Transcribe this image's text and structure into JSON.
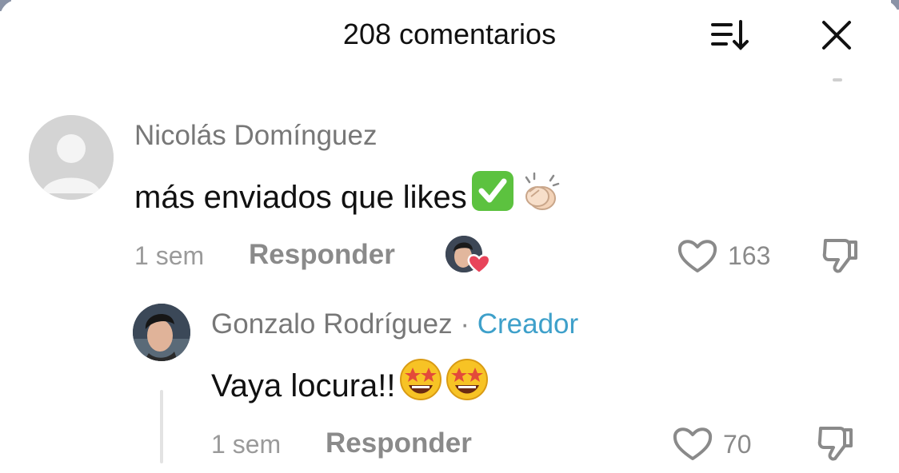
{
  "header": {
    "title": "208 comentarios"
  },
  "comments": [
    {
      "author": "Nicolás Domínguez",
      "text": "más enviados que likes",
      "time": "1 sem",
      "reply_label": "Responder",
      "likes": "163",
      "emojis": [
        "check-mark-emoji",
        "clapping-hands-emoji"
      ]
    }
  ],
  "reply": {
    "author": "Gonzalo Rodríguez",
    "separator": "·",
    "badge": "Creador",
    "text": "Vaya locura!!",
    "time": "1 sem",
    "reply_label": "Responder",
    "likes": "70",
    "emojis": [
      "star-struck-emoji",
      "star-struck-emoji"
    ]
  },
  "colors": {
    "creator_badge": "#3ea0ca",
    "liked_heart": "#e8445a",
    "check_green": "#5cc23f"
  }
}
